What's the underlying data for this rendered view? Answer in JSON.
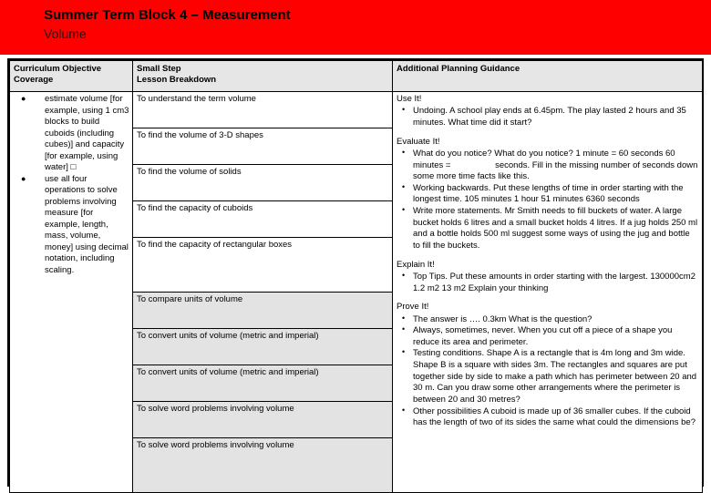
{
  "banner": {
    "title": "Summer Term Block 4 – Measurement",
    "subtitle": "Volume",
    "background_color": "#FE0000"
  },
  "table": {
    "headers": {
      "col1_line1": "Curriculum Objective",
      "col1_line2": "Coverage",
      "col2_line1": "Small Step",
      "col2_line2": "Lesson Breakdown",
      "col3": "Additional Planning Guidance"
    },
    "header_background": "#E6E6E6",
    "shaded_row_background": "#E3E3E3",
    "curriculum_objectives": [
      "estimate volume [for example, using 1 cm3 blocks to build cuboids (including cubes)] and capacity [for example, using water] □",
      "use all four operations to solve problems involving measure [for example, length, mass, volume, money] using decimal notation, including scaling."
    ],
    "small_steps": [
      "To understand the term volume",
      "To find the volume of 3-D shapes",
      "To find the volume of solids",
      "To find the capacity of cuboids",
      "To find the capacity of rectangular boxes",
      "To compare units of volume",
      "To convert units of volume (metric and imperial)",
      "To convert units of volume (metric and imperial)",
      "To solve word problems involving volume",
      "To solve word problems involving volume"
    ],
    "guidance_sections": [
      {
        "heading": "Use It!",
        "items": [
          "Undoing. A school play ends at 6.45pm. The play lasted 2 hours and 35 minutes. What time did it start?"
        ]
      },
      {
        "heading": "Evaluate It!",
        "items": [
          "What do you notice? What do you notice? 1 minute = 60 seconds 60 minutes = seconds. Fill in the missing number of seconds down some more time facts like this.",
          "Working backwards. Put these lengths of time in order starting with the longest time. 105 minutes 1 hour 51 minutes 6360 seconds",
          "Write more statements. Mr Smith needs to fill buckets of water. A large bucket holds 6 litres and a small bucket holds 4 litres. If a jug holds 250 ml and a bottle holds 500 ml suggest some ways of using the jug and bottle to fill the buckets."
        ]
      },
      {
        "heading": "Explain It!",
        "items": [
          "Top Tips. Put these amounts in order starting with the largest. 130000cm2  1.2 m2  13 m2 Explain your thinking"
        ]
      },
      {
        "heading": "Prove It!",
        "items": [
          "The answer is …. 0.3km What is the question?",
          "Always, sometimes, never. When you cut off a piece of a shape you reduce its area and perimeter.",
          "Testing conditions. Shape A is a rectangle that is 4m long and 3m wide. Shape B is a square with sides 3m. The rectangles and squares are put together side by side to make a path which has perimeter between 20 and 30 m. Can you draw some other arrangements where the perimeter is between 20 and 30 metres?",
          "Other possibilities A cuboid is made up of 36 smaller cubes. If the cuboid has the length of two of its sides the same what could the dimensions be?"
        ]
      }
    ]
  }
}
